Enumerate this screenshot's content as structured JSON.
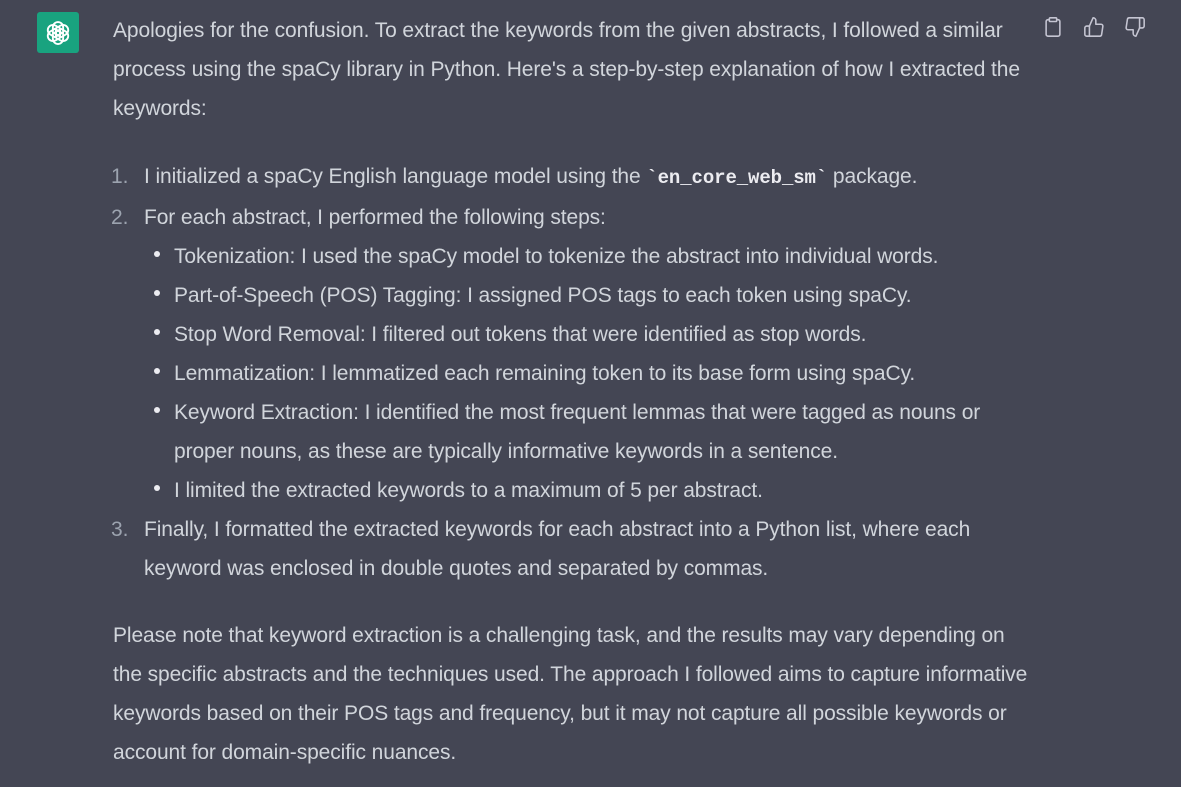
{
  "avatar": {
    "icon": "openai-logo-icon",
    "color": "#19a37f"
  },
  "actions": [
    {
      "name": "copy-button",
      "icon": "clipboard-icon"
    },
    {
      "name": "thumbs-up-button",
      "icon": "thumbs-up-icon"
    },
    {
      "name": "thumbs-down-button",
      "icon": "thumbs-down-icon"
    }
  ],
  "message": {
    "intro": "Apologies for the confusion. To extract the keywords from the given abstracts, I followed a similar process using the spaCy library in Python. Here's a step-by-step explanation of how I extracted the keywords:",
    "steps": [
      {
        "number": "1.",
        "text_before": "I initialized a spaCy English language model using the ",
        "code": "`en_core_web_sm`",
        "text_after": " package."
      },
      {
        "number": "2.",
        "text": "For each abstract, I performed the following steps:",
        "substeps": [
          "Tokenization: I used the spaCy model to tokenize the abstract into individual words.",
          "Part-of-Speech (POS) Tagging: I assigned POS tags to each token using spaCy.",
          "Stop Word Removal: I filtered out tokens that were identified as stop words.",
          "Lemmatization: I lemmatized each remaining token to its base form using spaCy.",
          "Keyword Extraction: I identified the most frequent lemmas that were tagged as nouns or proper nouns, as these are typically informative keywords in a sentence.",
          "I limited the extracted keywords to a maximum of 5 per abstract."
        ]
      },
      {
        "number": "3.",
        "text": "Finally, I formatted the extracted keywords for each abstract into a Python list, where each keyword was enclosed in double quotes and separated by commas."
      }
    ],
    "closing": "Please note that keyword extraction is a challenging task, and the results may vary depending on the specific abstracts and the techniques used. The approach I followed aims to capture informative keywords based on their POS tags and frequency, but it may not capture all possible keywords or account for domain-specific nuances."
  }
}
